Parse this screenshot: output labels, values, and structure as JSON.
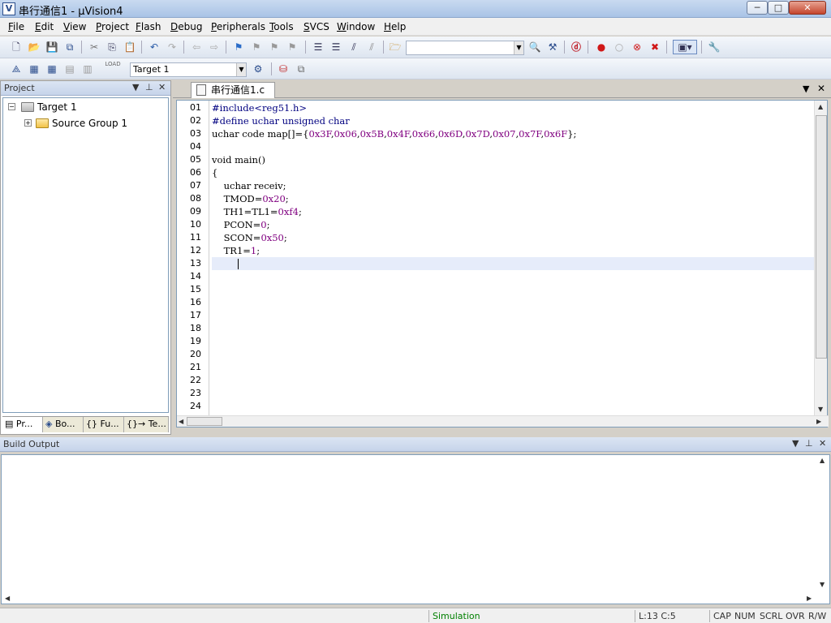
{
  "window": {
    "title": "串行通信1 - µVision4",
    "min_label": "─",
    "max_label": "□",
    "close_label": "✕",
    "app_icon": "V"
  },
  "menu": [
    {
      "label": "File",
      "key": "F",
      "rest": "ile"
    },
    {
      "label": "Edit",
      "key": "E",
      "rest": "dit"
    },
    {
      "label": "View",
      "key": "V",
      "rest": "iew"
    },
    {
      "label": "Project",
      "key": "P",
      "rest": "roject"
    },
    {
      "label": "Flash",
      "key": "F",
      "rest": "lash"
    },
    {
      "label": "Debug",
      "key": "D",
      "rest": "ebug"
    },
    {
      "label": "Peripherals",
      "key": "P",
      "rest": "eripherals"
    },
    {
      "label": "Tools",
      "key": "T",
      "rest": "ools"
    },
    {
      "label": "SVCS",
      "key": "S",
      "rest": "VCS"
    },
    {
      "label": "Window",
      "key": "W",
      "rest": "indow"
    },
    {
      "label": "Help",
      "key": "H",
      "rest": "elp"
    }
  ],
  "toolbar2": {
    "target_combo": "Target 1",
    "load_label": "LOAD"
  },
  "project_panel": {
    "title": "Project",
    "tree": {
      "root": "Target 1",
      "child": "Source Group 1"
    },
    "tabs": [
      "Pr...",
      "Bo...",
      "{} Fu...",
      "{}→ Te..."
    ]
  },
  "editor": {
    "file_tab": "串行通信1.c",
    "lines": [
      {
        "n": "01",
        "text": "#include<reg51.h>"
      },
      {
        "n": "02",
        "text": "#define uchar unsigned char"
      },
      {
        "n": "03",
        "text": "uchar code map[]={0x3F,0x06,0x5B,0x4F,0x66,0x6D,0x7D,0x07,0x7F,0x6F};"
      },
      {
        "n": "04",
        "text": ""
      },
      {
        "n": "05",
        "text": "void main()"
      },
      {
        "n": "06",
        "text": "{"
      },
      {
        "n": "07",
        "text": "    uchar receiv;"
      },
      {
        "n": "08",
        "text": "    TMOD=0x20;"
      },
      {
        "n": "09",
        "text": "    TH1=TL1=0xf4;"
      },
      {
        "n": "10",
        "text": "    PCON=0;"
      },
      {
        "n": "11",
        "text": "    SCON=0x50;"
      },
      {
        "n": "12",
        "text": "    TR1=1;"
      },
      {
        "n": "13",
        "text": ""
      },
      {
        "n": "14",
        "text": ""
      },
      {
        "n": "15",
        "text": ""
      },
      {
        "n": "16",
        "text": ""
      },
      {
        "n": "17",
        "text": ""
      },
      {
        "n": "18",
        "text": ""
      },
      {
        "n": "19",
        "text": ""
      },
      {
        "n": "20",
        "text": ""
      },
      {
        "n": "21",
        "text": ""
      },
      {
        "n": "22",
        "text": ""
      },
      {
        "n": "23",
        "text": ""
      },
      {
        "n": "24",
        "text": ""
      }
    ],
    "current_line": 13
  },
  "build_output": {
    "title": "Build Output"
  },
  "statusbar": {
    "mode": "Simulation",
    "position": "L:13 C:5",
    "caps": "CAP",
    "num": "NUM",
    "scrl": "SCRL",
    "ovr": "OVR",
    "rw": "R/W"
  },
  "colors": {
    "mode_text": "#008000",
    "numeric_literal": "#800080",
    "preprocessor": "#000080"
  }
}
